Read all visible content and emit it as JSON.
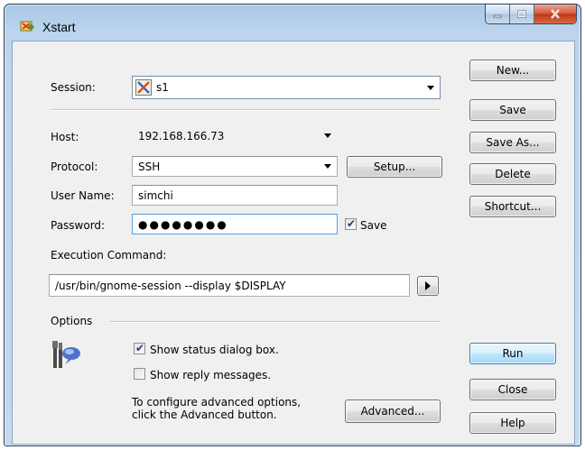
{
  "window": {
    "title": "Xstart"
  },
  "session": {
    "label": "Session:",
    "value": "s1"
  },
  "host": {
    "label": "Host:",
    "value": "192.168.166.73"
  },
  "protocol": {
    "label": "Protocol:",
    "value": "SSH",
    "setup_label": "Setup..."
  },
  "user_name": {
    "label": "User Name:",
    "value": "simchi"
  },
  "password": {
    "label": "Password:",
    "masked": "●●●●●●●●",
    "save_label": "Save",
    "save_checked": true
  },
  "execution": {
    "label": "Execution Command:",
    "value": "/usr/bin/gnome-session --display $DISPLAY"
  },
  "options": {
    "heading": "Options",
    "show_status_label": "Show status dialog box.",
    "show_status_checked": true,
    "show_reply_label": "Show reply messages.",
    "show_reply_checked": false,
    "advanced_hint_line1": "To configure advanced options,",
    "advanced_hint_line2": "click the Advanced button.",
    "advanced_label": "Advanced..."
  },
  "side_buttons": {
    "new": "New...",
    "save": "Save",
    "save_as": "Save As...",
    "delete": "Delete",
    "shortcut": "Shortcut...",
    "run": "Run",
    "close": "Close",
    "help": "Help"
  },
  "icons": {
    "app": "xstart-app-icon",
    "session": "x-session-icon",
    "options": "tools-help-icon",
    "run_arrow": "play-arrow-icon"
  }
}
